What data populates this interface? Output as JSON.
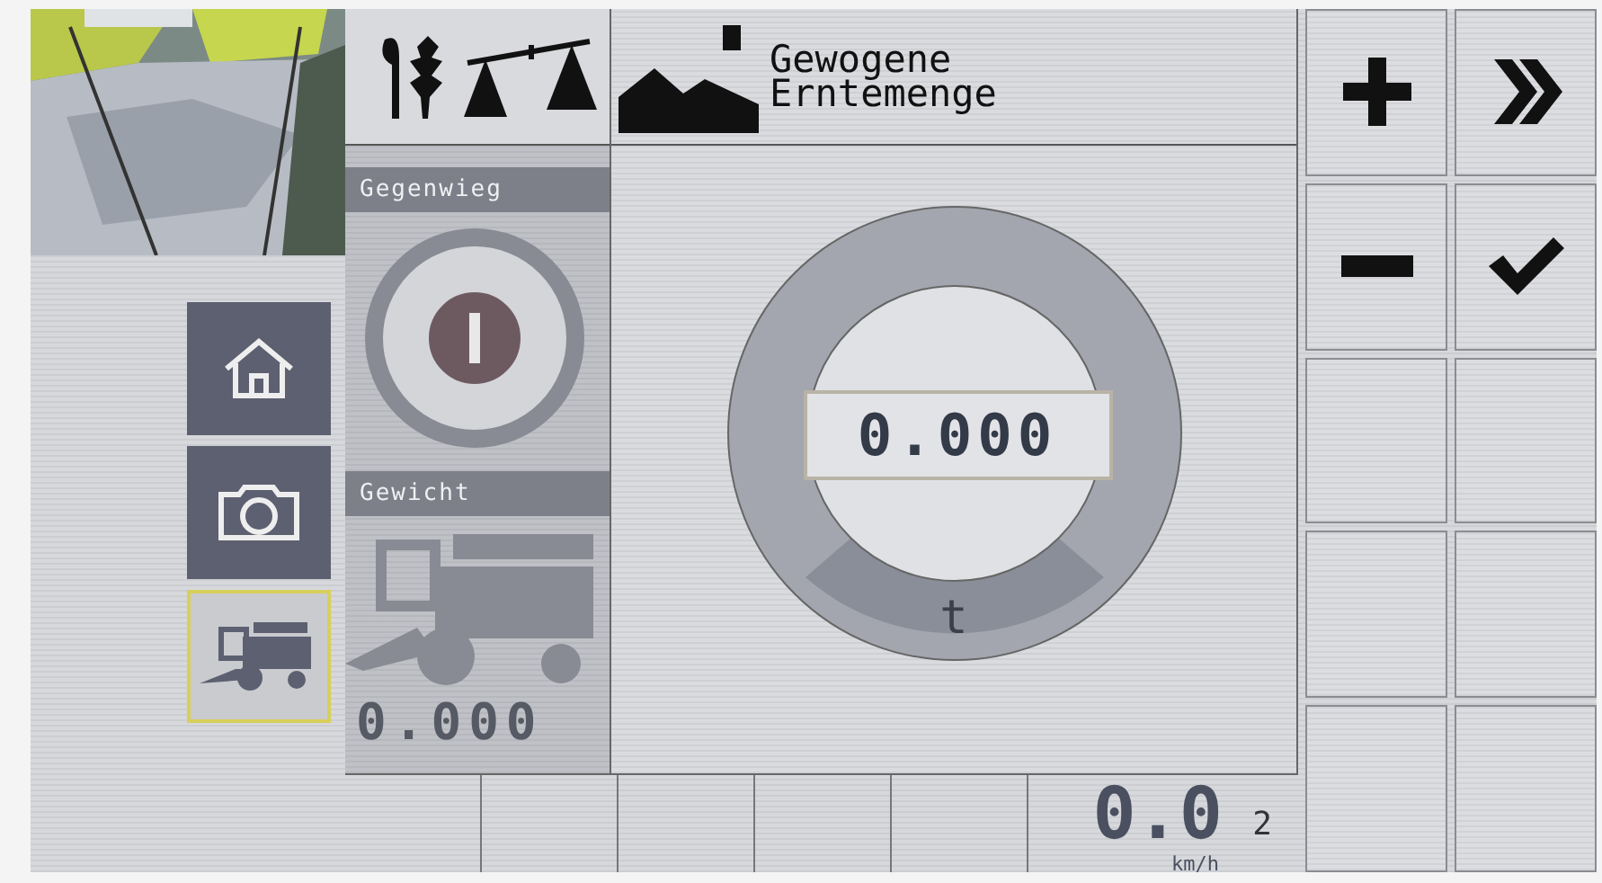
{
  "nav": [
    {
      "kind": "home",
      "selected": false
    },
    {
      "kind": "camera",
      "selected": false
    },
    {
      "kind": "combine",
      "selected": true
    }
  ],
  "panel": {
    "counterweight_label": "Gegenwieg",
    "counterweight_on": true,
    "weight_label": "Gewicht",
    "weight_value": "0.000"
  },
  "dialog": {
    "title_lines": [
      "Gewogene",
      "Erntemenge"
    ],
    "value": "0.000",
    "unit": "t"
  },
  "keys": [
    {
      "kind": "plus"
    },
    {
      "kind": "forward"
    },
    {
      "kind": "minus"
    },
    {
      "kind": "confirm"
    },
    {
      "kind": "empty"
    },
    {
      "kind": "empty"
    },
    {
      "kind": "empty"
    },
    {
      "kind": "empty"
    },
    {
      "kind": "empty"
    },
    {
      "kind": "empty"
    }
  ],
  "status_bar": {
    "speed_int": "0",
    "speed_sep": ".",
    "speed_dec": "0",
    "speed_unit": "km/h",
    "gear": "2"
  }
}
